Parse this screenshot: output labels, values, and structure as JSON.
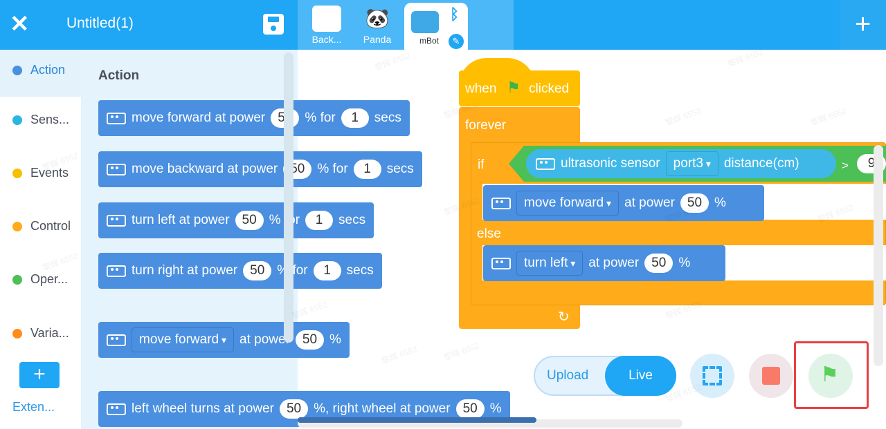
{
  "header": {
    "title": "Untitled(1)",
    "close_icon": "close-icon",
    "save_icon": "save-icon",
    "add_label": "+"
  },
  "sprites": [
    {
      "label": "Back..."
    },
    {
      "label": "Panda"
    },
    {
      "label": "mBot",
      "selected": true
    }
  ],
  "categories": [
    {
      "label": "Action",
      "color": "#4a8fe0",
      "selected": true
    },
    {
      "label": "Sens...",
      "color": "#2bb5e0"
    },
    {
      "label": "Events",
      "color": "#f5c000"
    },
    {
      "label": "Control",
      "color": "#ffab1a"
    },
    {
      "label": "Oper...",
      "color": "#4cbf56"
    },
    {
      "label": "Varia...",
      "color": "#ff8c1a"
    }
  ],
  "extension_label": "Exten...",
  "palette": {
    "title": "Action",
    "blocks": [
      {
        "a": "move forward at power",
        "v1": "50",
        "b": "% for",
        "v2": "1",
        "c": "secs"
      },
      {
        "a": "move backward at power",
        "v1": "50",
        "b": "% for",
        "v2": "1",
        "c": "secs"
      },
      {
        "a": "turn left at power",
        "v1": "50",
        "b": "% for",
        "v2": "1",
        "c": "secs"
      },
      {
        "a": "turn right at power",
        "v1": "50",
        "b": "% for",
        "v2": "1",
        "c": "secs"
      },
      {
        "dd": "move forward",
        "a": "at power",
        "v1": "50",
        "b": "%"
      },
      {
        "a": "left wheel turns at power",
        "v1": "50",
        "b": "%, right wheel at power",
        "v2": "50",
        "c": "%"
      }
    ]
  },
  "script": {
    "hat_when": "when",
    "hat_clicked": "clicked",
    "forever": "forever",
    "if": "if",
    "else": "else",
    "sensor": "ultrasonic sensor",
    "port": "port3",
    "distance": "distance(cm)",
    "op": ">",
    "threshold": "9",
    "then_dd": "move forward",
    "then_at": "at power",
    "then_val": "50",
    "then_pct": "%",
    "else_dd": "turn left",
    "else_at": "at power",
    "else_val": "50",
    "else_pct": "%"
  },
  "controls": {
    "upload": "Upload",
    "live": "Live",
    "mode": "Live"
  },
  "watermark": "黎辉 6552",
  "colors": {
    "header": "#1fa6f4",
    "motion": "#4a8fe0",
    "control": "#ffab1a",
    "event": "#ffbf00",
    "sensor": "#3fb8e8",
    "operator": "#4cbf56"
  }
}
